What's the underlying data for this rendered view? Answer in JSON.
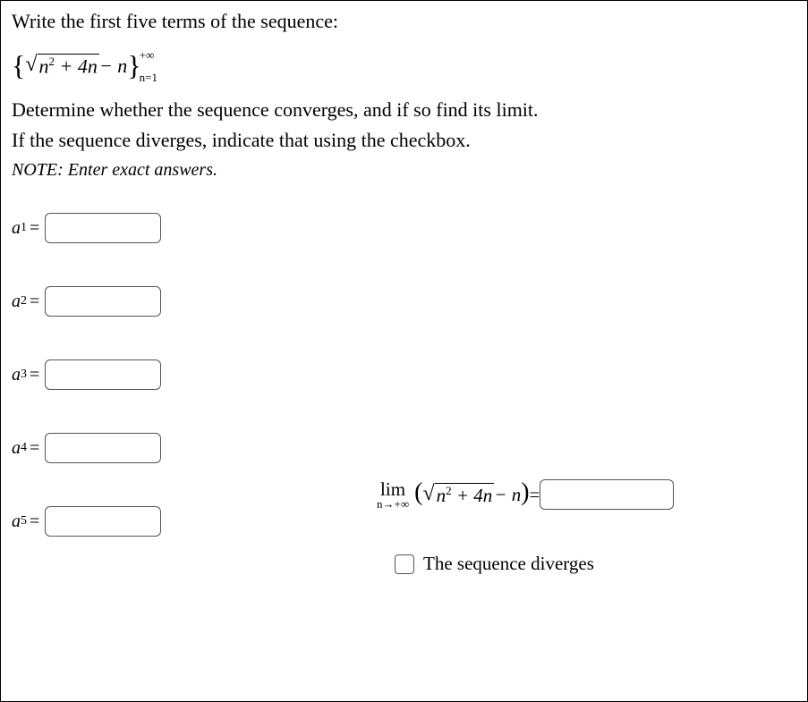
{
  "prompt": "Write the first five terms of the sequence:",
  "formula": {
    "radicand": "n",
    "radicand_exp": "2",
    "radicand_rest": " + 4n",
    "minus_n": " − n",
    "upper_bound": "+∞",
    "lower_bound": "n=1"
  },
  "instructions_line1": "Determine whether the sequence converges, and if so find its limit.",
  "instructions_line2": "If the sequence diverges, indicate that using the checkbox.",
  "note_label": "NOTE:  ",
  "note_text": "Enter exact answers.",
  "terms": [
    {
      "var": "a",
      "sub": "1",
      "value": ""
    },
    {
      "var": "a",
      "sub": "2",
      "value": ""
    },
    {
      "var": "a",
      "sub": "3",
      "value": ""
    },
    {
      "var": "a",
      "sub": "4",
      "value": ""
    },
    {
      "var": "a",
      "sub": "5",
      "value": ""
    }
  ],
  "limit": {
    "lim": "lim",
    "approach": "n→+∞",
    "radicand": "n",
    "radicand_exp": "2",
    "radicand_rest": " + 4n",
    "minus_n": " − n",
    "equals": " = ",
    "value": ""
  },
  "diverge_label": "The sequence diverges",
  "diverge_checked": false
}
